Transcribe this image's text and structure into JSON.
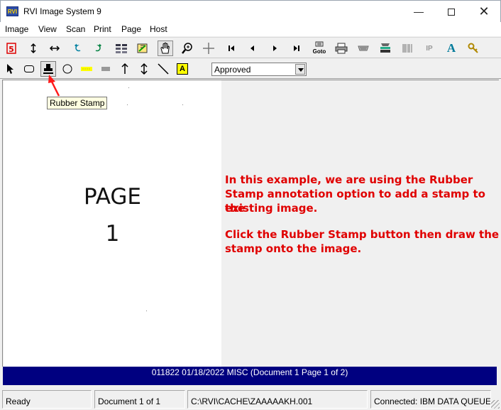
{
  "window": {
    "title": "RVI Image System 9",
    "app_icon_text": "RVI"
  },
  "menu": [
    "Image",
    "View",
    "Scan",
    "Print",
    "Page",
    "Host"
  ],
  "toolbar1": [
    {
      "name": "refresh-icon",
      "label": "5"
    },
    {
      "name": "fit-height-icon"
    },
    {
      "name": "fit-width-icon"
    },
    {
      "name": "rotate-left-icon"
    },
    {
      "name": "rotate-right-icon"
    },
    {
      "name": "thumbnails-icon"
    },
    {
      "name": "image-edit-icon"
    },
    {
      "name": "hand-pan-icon"
    },
    {
      "name": "zoom-in-icon"
    },
    {
      "name": "crosshair-icon"
    },
    {
      "name": "first-page-icon"
    },
    {
      "name": "previous-page-icon"
    },
    {
      "name": "next-page-icon"
    },
    {
      "name": "last-page-icon"
    },
    {
      "name": "goto-icon",
      "label": "Goto"
    },
    {
      "name": "print-icon"
    },
    {
      "name": "fax-icon"
    },
    {
      "name": "scanner-icon"
    },
    {
      "name": "barcode-icon"
    },
    {
      "name": "ip-icon",
      "label": "IP"
    },
    {
      "name": "text-font-icon",
      "label": "A"
    },
    {
      "name": "key-icon"
    }
  ],
  "toolbar2": [
    {
      "name": "select-pointer-icon"
    },
    {
      "name": "rounded-rectangle-icon"
    },
    {
      "name": "rubber-stamp-icon",
      "pressed": true
    },
    {
      "name": "ellipse-icon"
    },
    {
      "name": "highlighter-icon"
    },
    {
      "name": "filled-rectangle-icon"
    },
    {
      "name": "arrow-up-icon"
    },
    {
      "name": "double-arrow-icon"
    },
    {
      "name": "line-icon"
    },
    {
      "name": "text-annotation-icon",
      "label": "A"
    }
  ],
  "stamp_select": {
    "value": "Approved"
  },
  "tooltip": {
    "text": "Rubber Stamp"
  },
  "document": {
    "page_word": "PAGE",
    "page_number": "1"
  },
  "annotation": {
    "line1": "In this example, we are using the Rubber",
    "line2": "Stamp annotation option to add a stamp to the",
    "line3": "existing image.",
    "line4": "Click the Rubber Stamp button then draw the",
    "line5": "stamp onto the image."
  },
  "info_bar": {
    "text": "011822 01/18/2022 MISC (Document 1 Page 1 of 2)"
  },
  "status": {
    "ready": "Ready",
    "document": "Document 1 of 1",
    "path": "C:\\RVI\\CACHE\\ZAAAAAKH.001",
    "connection": "Connected: IBM DATA QUEUES"
  },
  "colors": {
    "annotation_red": "#e00000",
    "info_bar_navy": "#000080",
    "tooltip_bg": "#ffffe1"
  }
}
